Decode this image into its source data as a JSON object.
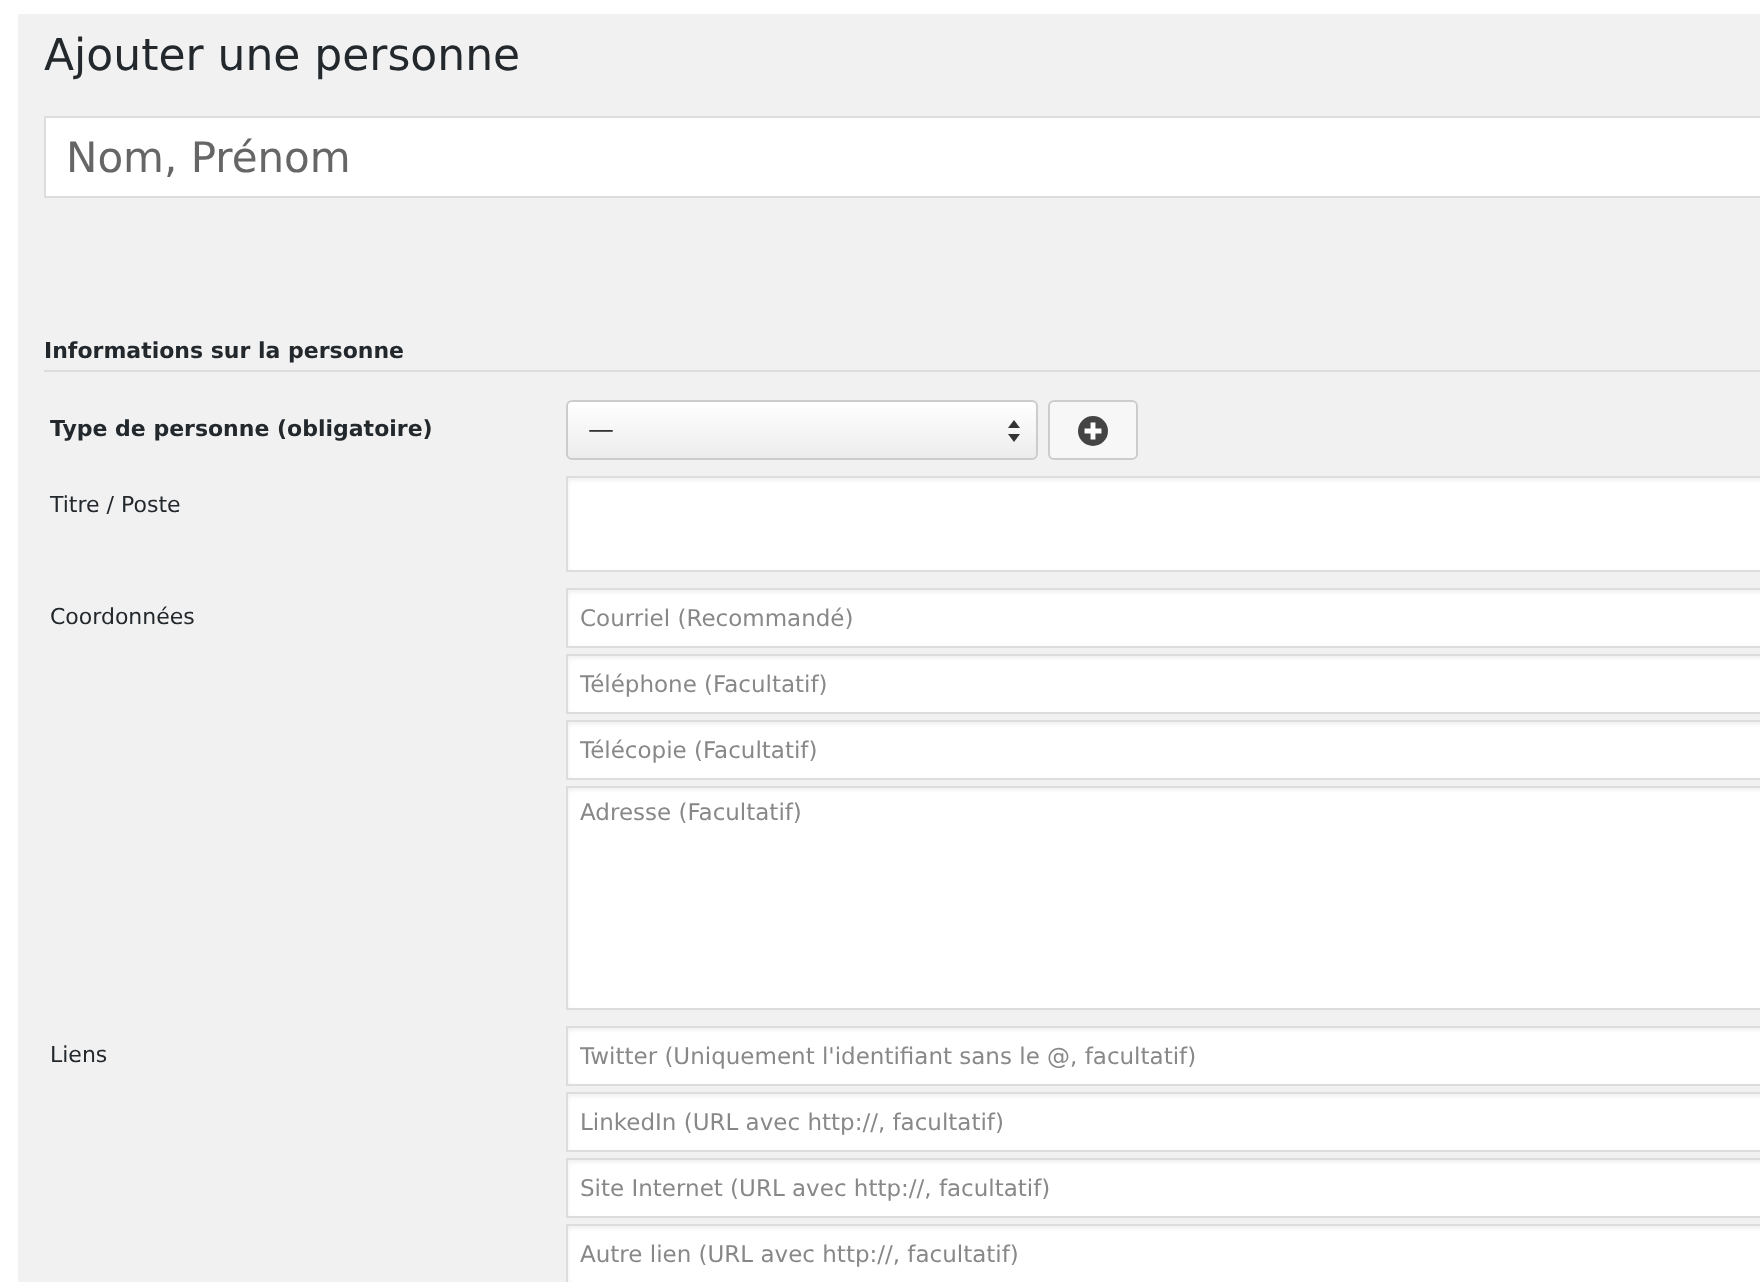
{
  "page_title": "Ajouter une personne",
  "name_field": {
    "placeholder": "Nom, Prénom"
  },
  "section": {
    "title": "Informations sur la personne",
    "rows": [
      {
        "kind": "select",
        "label": "Type de personne (obligatoire)",
        "value": "—"
      },
      {
        "kind": "textarea",
        "label": "Titre / Poste"
      },
      {
        "kind": "fields",
        "label": "Coordonnées",
        "fields": [
          {
            "kind": "input",
            "placeholder": "Courriel (Recommandé)"
          },
          {
            "kind": "input",
            "placeholder": "Téléphone (Facultatif)"
          },
          {
            "kind": "input",
            "placeholder": "Télécopie (Facultatif)"
          },
          {
            "kind": "textarea",
            "placeholder": "Adresse (Facultatif)"
          }
        ]
      },
      {
        "kind": "fields",
        "label": "Liens",
        "fields": [
          {
            "kind": "input",
            "placeholder": "Twitter (Uniquement l'identifiant sans le @, facultatif)"
          },
          {
            "kind": "input",
            "placeholder": "LinkedIn (URL avec http://, facultatif)"
          },
          {
            "kind": "input",
            "placeholder": "Site Internet (URL avec http://, facultatif)"
          },
          {
            "kind": "input",
            "placeholder": "Autre lien (URL avec http://, facultatif)"
          }
        ]
      }
    ]
  }
}
